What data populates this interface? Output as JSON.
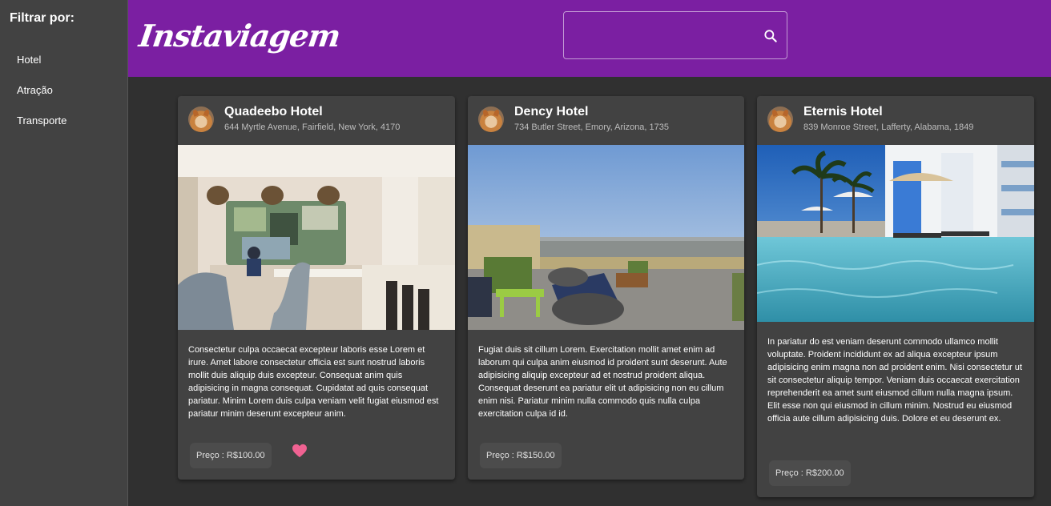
{
  "sidebar": {
    "title": "Filtrar por:",
    "items": [
      {
        "label": "Hotel"
      },
      {
        "label": "Atração"
      },
      {
        "label": "Transporte"
      }
    ]
  },
  "header": {
    "logo": "Instaviagem",
    "search": {
      "placeholder": "",
      "value": "",
      "icon": "search-icon"
    }
  },
  "colors": {
    "header": "#7b1fa2",
    "background": "#303030",
    "card": "#424242",
    "sidebar": "#424242",
    "heart": "#f06292"
  },
  "cards": [
    {
      "title": "Quadeebo Hotel",
      "address": "644 Myrtle Avenue, Fairfield, New York, 4170",
      "image": "hotel-lobby-photo",
      "text": "Consectetur culpa occaecat excepteur laboris esse Lorem et irure. Amet labore consectetur officia est sunt nostrud laboris mollit duis aliquip duis excepteur. Consequat anim quis adipisicing in magna consequat. Cupidatat ad quis consequat pariatur. Minim Lorem duis culpa veniam velit fugiat eiusmod est pariatur minim deserunt excepteur anim.",
      "price": "Preço : R$100.00",
      "favorited": true
    },
    {
      "title": "Dency Hotel",
      "address": "734 Butler Street, Emory, Arizona, 1735",
      "image": "rooftop-terrace-photo",
      "text": "Fugiat duis sit cillum Lorem. Exercitation mollit amet enim ad laborum qui culpa anim eiusmod id proident sunt deserunt. Aute adipisicing aliquip excepteur ad et nostrud proident aliqua. Consequat deserunt ea pariatur elit ut adipisicing non eu cillum enim nisi. Pariatur minim nulla commodo quis nulla culpa exercitation culpa id id.",
      "price": "Preço : R$150.00",
      "favorited": false
    },
    {
      "title": "Eternis Hotel",
      "address": "839 Monroe Street, Lafferty, Alabama, 1849",
      "image": "pool-palms-photo",
      "text": "In pariatur do est veniam deserunt commodo ullamco mollit voluptate. Proident incididunt ex ad aliqua excepteur ipsum adipisicing enim magna non ad proident enim. Nisi consectetur ut sit consectetur aliquip tempor. Veniam duis occaecat exercitation reprehenderit ea amet sunt eiusmod cillum nulla magna ipsum. Elit esse non qui eiusmod in cillum minim. Nostrud eu eiusmod officia aute cillum adipisicing duis. Dolore et eu deserunt ex.",
      "price": "Preço : R$200.00",
      "favorited": false
    }
  ]
}
